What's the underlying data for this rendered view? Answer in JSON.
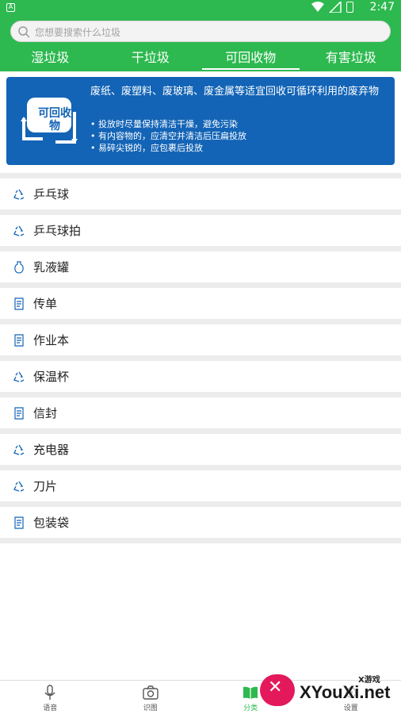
{
  "status_bar": {
    "time": "2:47",
    "notification": "A"
  },
  "search": {
    "placeholder": "您想要搜索什么垃圾"
  },
  "tabs": [
    {
      "label": "湿垃圾"
    },
    {
      "label": "干垃圾"
    },
    {
      "label": "可回收物",
      "active": true
    },
    {
      "label": "有害垃圾"
    }
  ],
  "banner": {
    "logo_text": "可回收物",
    "heading": "废纸、废塑料、废玻璃、废金属等适宜回收可循环利用的废弃物",
    "tips": [
      "• 投放时尽量保持清洁干燥，避免污染",
      "• 有内容物的，应清空并清洁后压扁投放",
      "• 易碎尖锐的，应包裹后投放"
    ],
    "color": "#1364b6"
  },
  "items": [
    {
      "label": "乒乓球",
      "icon": "recycle-icon"
    },
    {
      "label": "乒乓球拍",
      "icon": "recycle-icon"
    },
    {
      "label": "乳液罐",
      "icon": "bottle-icon"
    },
    {
      "label": "传单",
      "icon": "paper-icon"
    },
    {
      "label": "作业本",
      "icon": "paper-icon"
    },
    {
      "label": "保温杯",
      "icon": "recycle-icon"
    },
    {
      "label": "信封",
      "icon": "paper-icon"
    },
    {
      "label": "充电器",
      "icon": "recycle-icon"
    },
    {
      "label": "刀片",
      "icon": "recycle-icon"
    },
    {
      "label": "包装袋",
      "icon": "paper-icon"
    }
  ],
  "bottom_nav": [
    {
      "label": "语音",
      "icon": "microphone-icon"
    },
    {
      "label": "识图",
      "icon": "camera-icon"
    },
    {
      "label": "分类",
      "icon": "book-icon",
      "active": true
    },
    {
      "label": "设置",
      "icon": "settings-icon"
    }
  ],
  "watermark": {
    "text": "XYouXi.net",
    "small": "X游戏"
  },
  "colors": {
    "primary": "#2db94f",
    "accent": "#1364b6"
  }
}
